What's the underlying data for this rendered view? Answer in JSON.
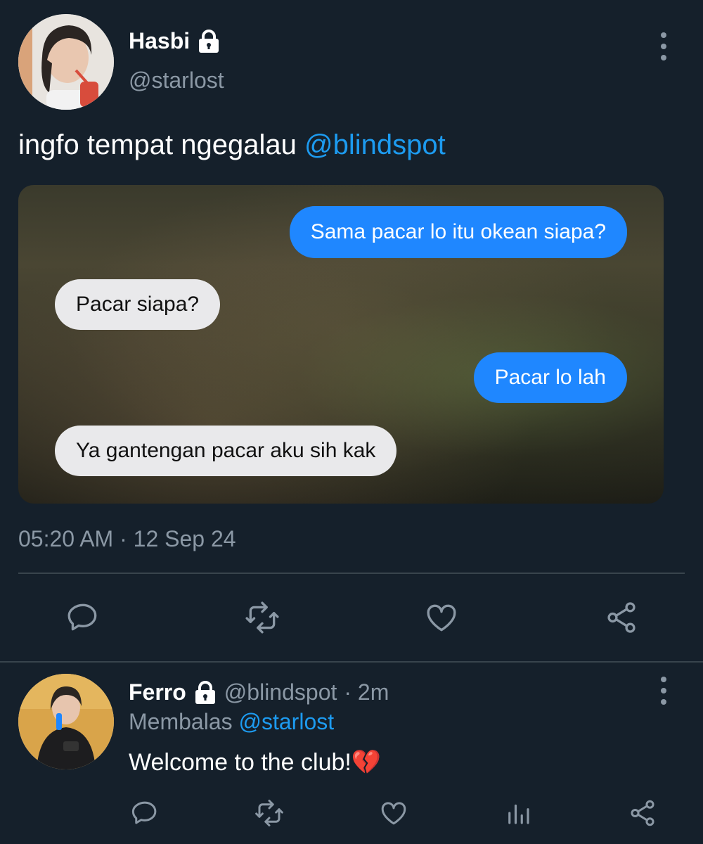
{
  "tweet": {
    "author_name": "Hasbi",
    "author_handle": "@starlost",
    "text_prefix": "ingfo tempat ngegalau ",
    "text_mention": "@blindspot",
    "timestamp": "05:20 AM · 12 Sep 24",
    "media": {
      "messages": [
        {
          "side": "right",
          "text": "Sama pacar lo itu okean siapa?"
        },
        {
          "side": "left",
          "text": "Pacar siapa?"
        },
        {
          "side": "right",
          "text": "Pacar lo lah"
        },
        {
          "side": "left",
          "text": "Ya gantengan pacar aku sih kak"
        }
      ]
    },
    "actions": [
      "reply-icon",
      "retweet-icon",
      "like-icon",
      "share-icon"
    ]
  },
  "reply": {
    "author_name": "Ferro",
    "author_handle": "@blindspot",
    "time": "· 2m",
    "replying_prefix": "Membalas ",
    "replying_to": "@starlost",
    "text": "Welcome to the club!💔",
    "actions": [
      "reply-icon",
      "retweet-icon",
      "like-icon",
      "analytics-icon",
      "share-icon"
    ]
  },
  "colors": {
    "background": "#15202b",
    "accent": "#1d9bf0",
    "muted": "#8b98a5",
    "bubble_blue": "#1f87ff",
    "bubble_gray": "#e9e9eb"
  }
}
